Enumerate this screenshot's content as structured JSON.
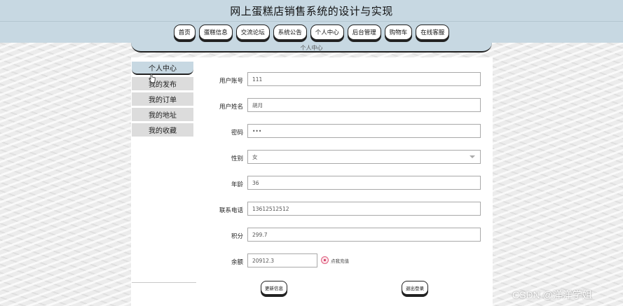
{
  "site": {
    "title": "网上蛋糕店销售系统的设计与实现"
  },
  "nav": {
    "items": [
      {
        "label": "首页"
      },
      {
        "label": "蛋糕信息"
      },
      {
        "label": "交流论坛"
      },
      {
        "label": "系统公告"
      },
      {
        "label": "个人中心"
      },
      {
        "label": "后台管理"
      },
      {
        "label": "购物车"
      },
      {
        "label": "在线客服"
      }
    ]
  },
  "section": {
    "title": "个人中心"
  },
  "sidebar": {
    "items": [
      {
        "label": "个人中心",
        "active": true
      },
      {
        "label": "我的发布"
      },
      {
        "label": "我的订单"
      },
      {
        "label": "我的地址"
      },
      {
        "label": "我的收藏"
      }
    ]
  },
  "form": {
    "account": {
      "label": "用户账号",
      "value": "111"
    },
    "name": {
      "label": "用户姓名",
      "value": "胡月"
    },
    "password": {
      "label": "密码",
      "value": "•••"
    },
    "gender": {
      "label": "性别",
      "value": "女"
    },
    "age": {
      "label": "年龄",
      "value": "36"
    },
    "phone": {
      "label": "联系电话",
      "value": "13612512512"
    },
    "points": {
      "label": "积分",
      "value": "299.7"
    },
    "balance": {
      "label": "余额",
      "value": "20912.3"
    },
    "recharge_label": "点我充值",
    "update_label": "更新信息",
    "logout_label": "退出登录"
  },
  "watermark": "CSDN @洋洋学姐",
  "colors": {
    "header_bg": "#c7d8e2",
    "sidebar_item_bg": "#dcdcdc",
    "button_border": "#222222"
  },
  "icons": {
    "cursor": "hand-pointer-icon",
    "recharge": "recharge-icon"
  }
}
